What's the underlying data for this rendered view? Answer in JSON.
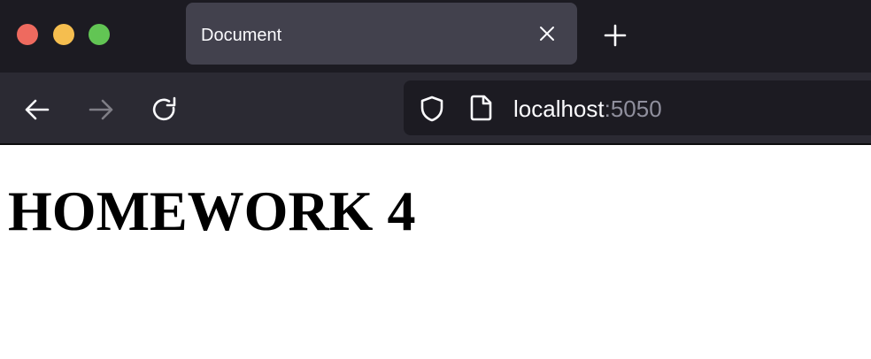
{
  "window_controls": {
    "close_color": "#ee6a5f",
    "minimize_color": "#f5be4f",
    "maximize_color": "#62c554"
  },
  "tab": {
    "title": "Document",
    "close_icon": "close-icon"
  },
  "new_tab_icon": "plus-icon",
  "nav": {
    "back_icon": "arrow-left-icon",
    "forward_icon": "arrow-right-icon",
    "forward_enabled": false,
    "reload_icon": "reload-icon"
  },
  "address_bar": {
    "host": "localhost",
    "port": ":5050",
    "security_icon": "shield-icon",
    "page_icon": "page-icon"
  },
  "page": {
    "heading": "HOMEWORK 4"
  },
  "colors": {
    "tabbar_bg": "#1c1b22",
    "toolbar_bg": "#2b2a33",
    "active_tab_bg": "#42414d",
    "page_bg": "#ffffff"
  }
}
